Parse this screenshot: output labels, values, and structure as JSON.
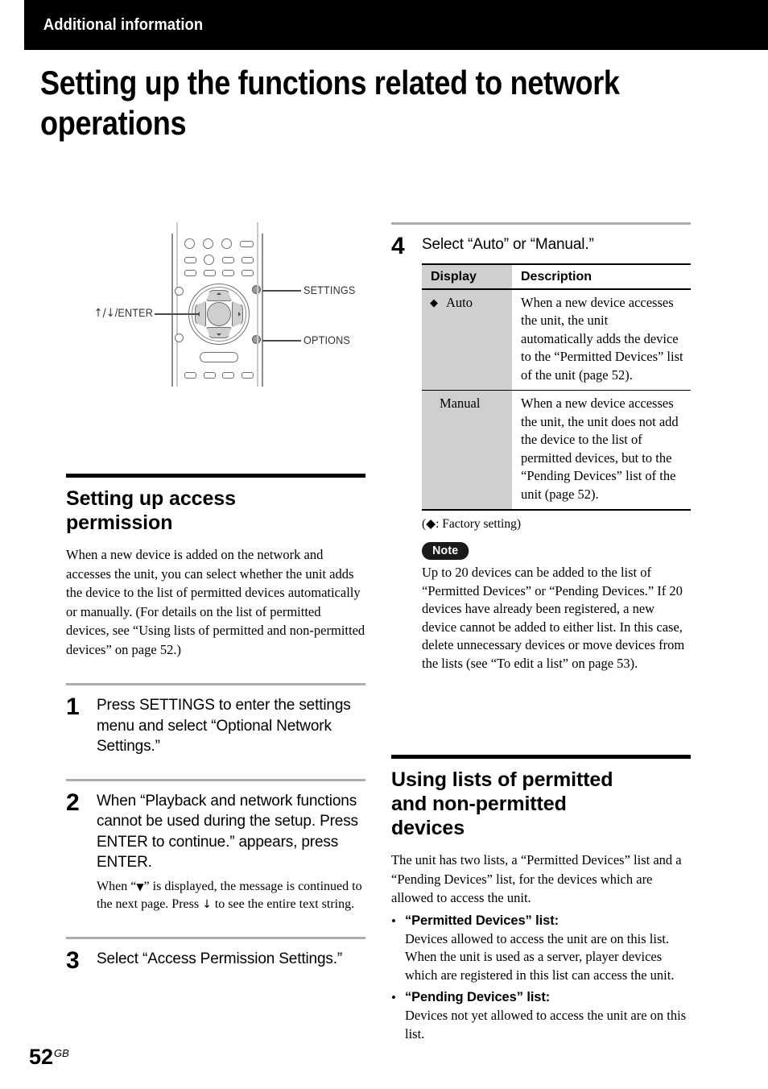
{
  "header": {
    "running_title": "Additional information"
  },
  "page_title": "Setting up the functions related to network\noperations",
  "figure": {
    "label_dpad": "/ENTER",
    "label_dpad_arrows": "↑/↓",
    "callouts": [
      {
        "label": "SETTINGS"
      },
      {
        "label": "OPTIONS"
      }
    ]
  },
  "left_column": {
    "section": {
      "heading": "Setting up access\npermission",
      "intro": "When a new device is added on the network and accesses the unit, you can select whether the unit adds the device to the list of permitted devices automatically or manually. (For details on the list of permitted devices, see “Using lists of permitted and non-permitted devices” on page 52.)"
    },
    "steps": [
      {
        "number": "1",
        "text": "Press SETTINGS to enter the settings menu and select “Optional Network Settings.”"
      },
      {
        "number": "2",
        "text": "When “Playback and network functions cannot be used during the setup. Press ENTER to continue.” appears, press ENTER.",
        "sub_before": "When “",
        "sub_glyph_1": "▼",
        "sub_middle": "” is displayed, the message is continued to the next page. Press ",
        "sub_glyph_2": "↓",
        "sub_after": " to see the entire text string."
      },
      {
        "number": "3",
        "text": "Select “Access Permission Settings.”"
      }
    ]
  },
  "right_column": {
    "step4": {
      "number": "4",
      "text": "Select “Auto” or “Manual.”",
      "table": {
        "headers": [
          "Display",
          "Description"
        ],
        "rows": [
          {
            "marker": "◆",
            "display": "Auto",
            "description": "When a new device accesses the unit, the unit automatically adds the device to the “Permitted Devices” list of the unit (page 52)."
          },
          {
            "marker": "",
            "display": "Manual",
            "description": "When a new device accesses the unit, the unit does not add the device to the list of permitted devices, but to the “Pending Devices” list of the unit (page 52)."
          }
        ]
      },
      "factory_note": "(◆: Factory setting)"
    },
    "note": {
      "badge": "Note",
      "text": "Up to 20 devices can be added to the list of “Permitted Devices” or “Pending Devices.” If 20 devices have already been registered, a new device cannot be added to either list. In this case, delete unnecessary devices or move devices from the lists (see “To edit a list” on page 53)."
    },
    "section2": {
      "heading": "Using lists of permitted\nand non-permitted\ndevices",
      "intro": "The unit has two lists, a “Permitted Devices” list and a “Pending Devices” list, for the devices which are allowed to access the unit.",
      "bullets": [
        {
          "dot": "•",
          "title": "“Permitted Devices” list:",
          "text": "Devices allowed to access the unit are on this list.\nWhen the unit is used as a server, player devices which are registered in this list can access the unit."
        },
        {
          "dot": "•",
          "title": "“Pending Devices” list:",
          "text": "Devices not yet allowed to access the unit are on this list."
        }
      ]
    }
  },
  "footer": {
    "page_number": "52",
    "page_suffix": "GB"
  }
}
